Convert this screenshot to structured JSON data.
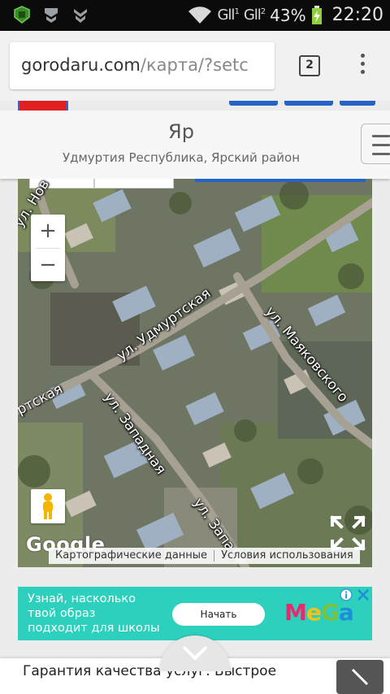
{
  "status_bar": {
    "signal_1": "Gll",
    "signal_1_sup": "1",
    "signal_2": "Gll",
    "signal_2_sup": "2",
    "battery": "43%",
    "time": "22:20"
  },
  "browser": {
    "url_host": "gorodaru.com",
    "url_path": "/карта/?setc",
    "tab_count": "2"
  },
  "header": {
    "title": "Яр",
    "subtitle": "Удмуртия Республика, Ярский район"
  },
  "map": {
    "zoom_in": "+",
    "zoom_out": "−",
    "streets": [
      "ул. Нов",
      "ул. Удмуртская",
      "ул. Маяковского",
      "ртская",
      "ул. Западная",
      "ул. Запад"
    ],
    "google_logo": "Google",
    "footer_data": "Картографические данные",
    "footer_terms": "Условия использования"
  },
  "ad": {
    "line1": "Узнай, насколько",
    "line2": "твой образ",
    "line3": "подходит для школы",
    "button": "Начать",
    "brand": "MeGa",
    "accent": "#2dd0bc"
  },
  "bottom_banner": {
    "text": "Гарантия качества услуг. Быстрое"
  }
}
